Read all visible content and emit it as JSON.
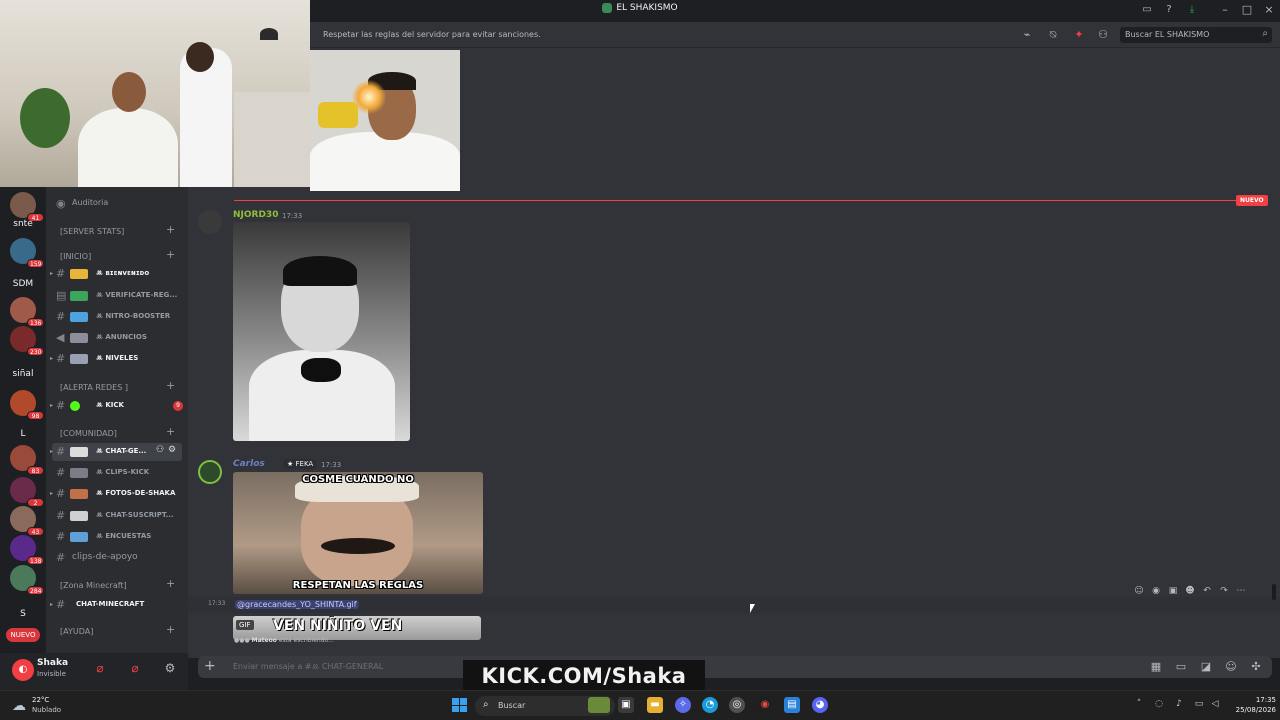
{
  "window": {
    "title": "EL SHAKISMO"
  },
  "header": {
    "topic": "Respetar las reglas del servidor para evitar sanciones.",
    "search_placeholder": "Buscar EL SHAKISMO"
  },
  "servers": [
    {
      "label": "",
      "badge": "41"
    },
    {
      "label": "snte",
      "badge": ""
    },
    {
      "label": "",
      "badge": "159"
    },
    {
      "label": "SDM",
      "badge": ""
    },
    {
      "label": "",
      "badge": "136"
    },
    {
      "label": "",
      "badge": "230"
    },
    {
      "label": "siñal",
      "badge": ""
    },
    {
      "label": "",
      "badge": "98"
    },
    {
      "label": "L",
      "badge": ""
    },
    {
      "label": "",
      "badge": "83"
    },
    {
      "label": "",
      "badge": "2"
    },
    {
      "label": "",
      "badge": "43"
    },
    {
      "label": "",
      "badge": "138"
    },
    {
      "label": "",
      "badge": "284"
    },
    {
      "label": "S",
      "badge": ""
    }
  ],
  "servers_new_label": "NUEVO",
  "sidebar": {
    "audit": "Auditoria",
    "categories": {
      "server_stats": "[SERVER STATS]",
      "inicio": "[INICIO]",
      "alerta": "[ALERTA REDES ]",
      "comunidad": "[COMUNIDAD]",
      "minecraft": "[Zona Minecraft]",
      "ayuda": "[AYUDA]"
    },
    "channels": {
      "bienvenido": "ꔛ ʙɪᴇɴᴠᴇɴɪᴅᴏ",
      "verificate": "ꔛ VERIFICATE-REG...",
      "nitro": "ꔛ NITRO-BOOSTER",
      "anuncios": "ꔛ ANUNCIOS",
      "niveles": "ꔛ NIVELES",
      "kick": "ꔛ KICK",
      "kick_badge": "9",
      "chat_general": "ꔛ CHAT-GE...",
      "clips_kick": "ꔛ CLIPS-KICK",
      "fotos": "ꔛ FOTOS-DE-SHAKA",
      "chat_suscript": "ꔛ CHAT-SUSCRIPT...",
      "encuestas": "ꔛ ENCUESTAS",
      "clips_apoyo": "clips-de-apoyo",
      "chat_minecraft": "CHAT-MINECRAFT"
    }
  },
  "user": {
    "name": "Shaka",
    "status": "Invisible"
  },
  "messages": [
    {
      "author": "NJORD30",
      "time": "17:33",
      "color": "#8fbf3a"
    },
    {
      "author": "Carlos",
      "role_tag": "FEKA",
      "time": "17:33",
      "color": "#6d7fbf",
      "meme_top": "COSME CUANDO NO",
      "meme_bottom": "RESPETAN LAS REGLAS"
    }
  ],
  "new_label": "NUEVO",
  "reply": {
    "time": "17:33",
    "mention": "@gracecandes_YO_SHINTA.gif"
  },
  "gif_preview": {
    "tag": "GIF",
    "text": "VEN NIÑITO VEN"
  },
  "typing": {
    "name": "Mateoo",
    "text": "está escribiendo..."
  },
  "input": {
    "placeholder": "Enviar mensaje a #ꔛ CHAT-GENERAL"
  },
  "overlay": {
    "kick": "KICK.COM/Shaka"
  },
  "taskbar": {
    "temp": "22°C",
    "weather": "Nublado",
    "search": "Buscar",
    "time": "17:35",
    "date": "25/08/2026"
  },
  "colors": {
    "accent_red": "#f23f43",
    "mention": "#c9cdfb"
  }
}
